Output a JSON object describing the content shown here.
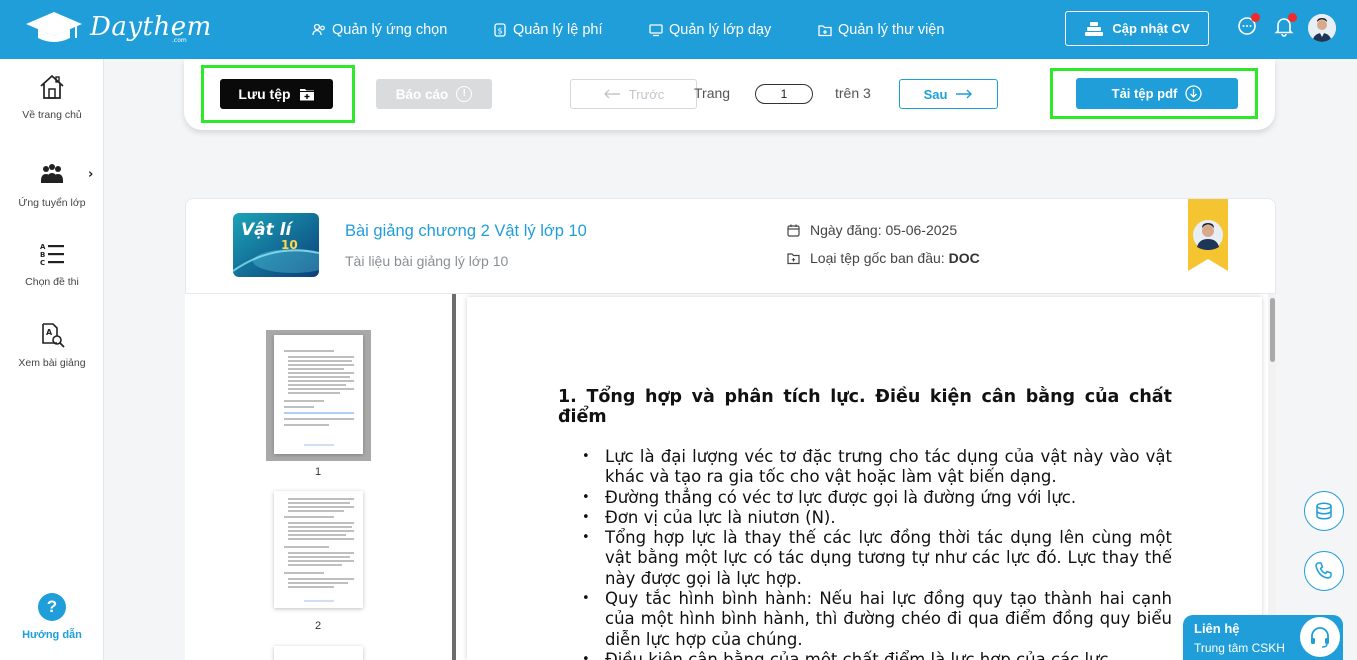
{
  "header": {
    "brand": "Daythem",
    "brand_sub": ".com",
    "nav": [
      {
        "label": "Quản lý ứng chọn",
        "icon": "users-icon"
      },
      {
        "label": "Quản lý lệ phí",
        "icon": "fee-icon"
      },
      {
        "label": "Quản lý lớp dạy",
        "icon": "class-icon"
      },
      {
        "label": "Quản lý thư viện",
        "icon": "library-icon"
      }
    ],
    "cv_button": "Cập nhật CV",
    "chat_badge": true,
    "notification_badge": true
  },
  "sidebar": {
    "items": [
      {
        "label": "Về trang chủ",
        "icon": "home-icon"
      },
      {
        "label": "Ứng tuyển lớp",
        "icon": "group-icon"
      },
      {
        "label": "Chọn đề thi",
        "icon": "abc-list-icon"
      },
      {
        "label": "Xem bài giảng",
        "icon": "lecture-search-icon"
      }
    ],
    "help_label": "Hướng dẫn",
    "help_symbol": "?"
  },
  "toolbar": {
    "save_label": "Lưu tệp",
    "report_label": "Báo cáo",
    "report_symbol": "!",
    "prev_label": "Trước",
    "page_label": "Trang",
    "page_value": "1",
    "of_label": "trên 3",
    "next_label": "Sau",
    "pdf_label": "Tải tệp pdf"
  },
  "document": {
    "cover_text": "Vật lí",
    "cover_number": "10",
    "title": "Bài giảng chương 2 Vật lý lớp 10",
    "description": "Tài liệu bài giảng lý lớp 10",
    "date_label": "Ngày đăng:",
    "date_value": "05-06-2025",
    "filetype_label": "Loại tệp gốc ban đầu:",
    "filetype_value": "DOC"
  },
  "thumbnails": [
    {
      "number": "1",
      "selected": true
    },
    {
      "number": "2",
      "selected": false
    }
  ],
  "page_content": {
    "heading": "1. Tổng hợp và phân tích lực. Điều kiện cân bằng của chất điểm",
    "bullets": [
      "Lực là đại lượng véc tơ đặc trưng cho tác dụng của vật này vào vật khác và tạo ra gia tốc cho vật hoặc làm vật biến dạng.",
      "Đường thẳng có véc tơ lực được gọi là đường ứng với lực.",
      "Đơn vị của lực là niutơn (N).",
      "Tổng hợp lực là thay thế các lực đồng thời tác dụng lên cùng một vật bằng một lực có tác dụng tương tự như các lực đó. Lực thay thế này được gọi là lực hợp.",
      "Quy tắc hình bình hành: Nếu hai lực đồng quy tạo thành hai cạnh của một hình bình hành, thì đường chéo đi qua điểm đồng quy biểu diễn lực hợp của chúng.",
      "Điều kiện cân bằng của một chất điểm là lực hợp của các lực"
    ]
  },
  "contact": {
    "title": "Liên hệ",
    "subtitle": "Trung tâm CSKH"
  },
  "colors": {
    "primary": "#1f9ed9",
    "highlight": "#2ee82a",
    "badge": "#f02a2a",
    "ribbon": "#f5c531"
  }
}
